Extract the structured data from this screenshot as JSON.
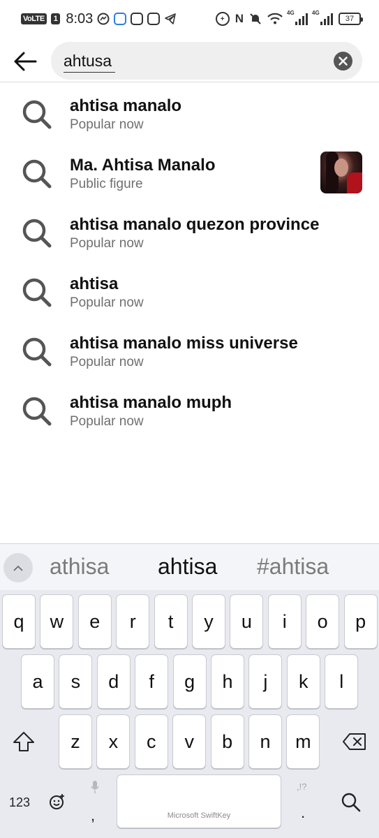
{
  "status_bar": {
    "volte": "VoLTE",
    "sim": "1",
    "time": "8:03",
    "nfc": "N",
    "net1": "4G",
    "net2": "4G",
    "battery": "37"
  },
  "search": {
    "query": "ahtusa",
    "placeholder": ""
  },
  "results": [
    {
      "title": "ahtisa manalo",
      "subtitle": "Popular now",
      "thumbnail": false
    },
    {
      "title": "Ma. Ahtisa Manalo",
      "subtitle": "Public figure",
      "thumbnail": true
    },
    {
      "title": "ahtisa manalo quezon province",
      "subtitle": "Popular now",
      "thumbnail": false
    },
    {
      "title": "ahtisa",
      "subtitle": "Popular now",
      "thumbnail": false
    },
    {
      "title": "ahtisa manalo miss universe",
      "subtitle": "Popular now",
      "thumbnail": false
    },
    {
      "title": "ahtisa manalo muph",
      "subtitle": "Popular now",
      "thumbnail": false
    }
  ],
  "keyboard": {
    "suggestions": [
      "athisa",
      "ahtisa",
      "#ahtisa"
    ],
    "row1": [
      "q",
      "w",
      "e",
      "r",
      "t",
      "y",
      "u",
      "i",
      "o",
      "p"
    ],
    "row2": [
      "a",
      "s",
      "d",
      "f",
      "g",
      "h",
      "j",
      "k",
      "l"
    ],
    "row3": [
      "z",
      "x",
      "c",
      "v",
      "b",
      "n",
      "m"
    ],
    "numbers_key": "123",
    "comma": ",",
    "period": ".",
    "punct_hint": ",!?",
    "space_label": "Microsoft SwiftKey"
  }
}
